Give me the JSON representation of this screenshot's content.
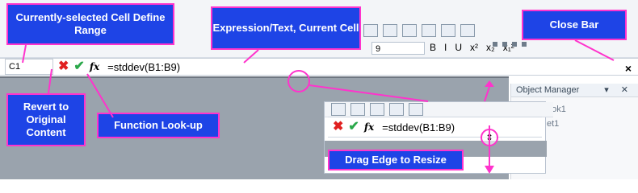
{
  "formula_bar": {
    "cell_ref": "C1",
    "expression": "=stddev(B1:B9)",
    "close_glyph": "×"
  },
  "toolbar": {
    "font_size": "9",
    "format_buttons": [
      "B",
      "I",
      "U",
      "x²",
      "x₂",
      "x₁²"
    ]
  },
  "object_manager": {
    "title": "Object Manager",
    "items": [
      "ook1",
      "et1"
    ]
  },
  "callouts": {
    "cell_range": "Currently-selected Cell Define Range",
    "expression": "Expression/Text, Current Cell",
    "close_bar": "Close Bar",
    "revert": "Revert to Original Content",
    "function_lookup": "Function Look-up",
    "drag_edge": "Drag Edge to Resize"
  },
  "icons": {
    "revert": "red-x-icon",
    "accept": "green-check-icon",
    "function": "fx-icon",
    "close": "close-icon"
  },
  "colors": {
    "callout_fill": "#1e44e6",
    "callout_border": "#ff33cc",
    "workspace_gray": "#9aa3ad"
  }
}
